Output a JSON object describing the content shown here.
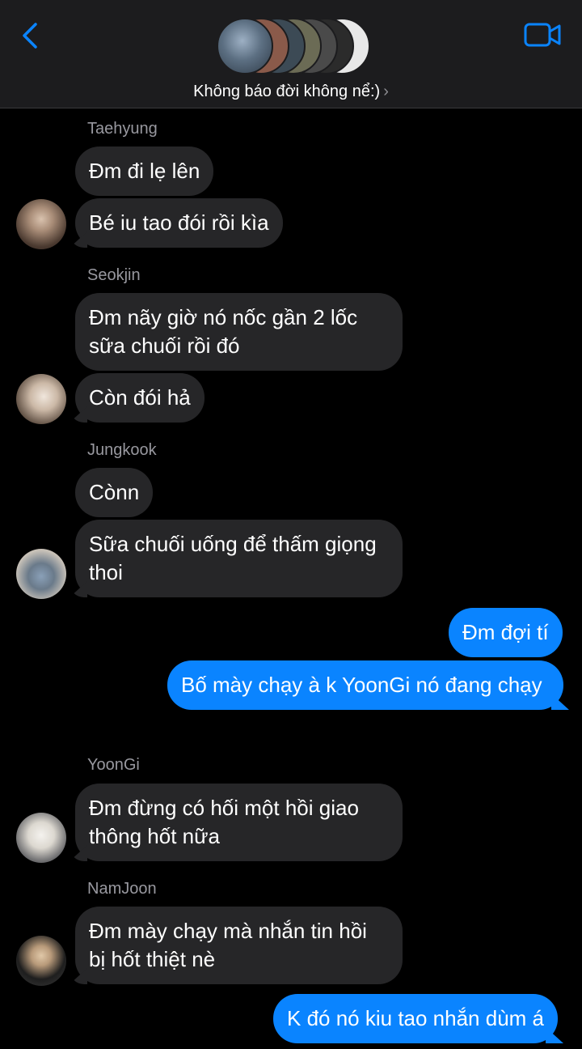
{
  "header": {
    "title": "Không báo đời không nể:)",
    "chevron": "›",
    "back_icon": "chevron-left-icon",
    "video_icon": "video-camera-icon",
    "accent": "#0a84ff",
    "group_avatar_count": 7
  },
  "messages": [
    {
      "sender": "Taehyung",
      "bubbles": [
        "Đm đi lẹ lên",
        "Bé iu tao đói rồi kìa"
      ]
    },
    {
      "sender": "Seokjin",
      "bubbles": [
        "Đm nãy giờ nó nốc gần 2 lốc sữa chuối rồi đó",
        "Còn đói hả"
      ]
    },
    {
      "sender": "Jungkook",
      "bubbles": [
        "Cònn",
        "Sữa chuối uống để thấm giọng thoi"
      ]
    },
    {
      "sender": "me",
      "bubbles": [
        "Đm đợi tí",
        "Bố mày chạy à k YoonGi nó đang chạy"
      ]
    },
    {
      "sender": "YoonGi",
      "bubbles": [
        "Đm đừng có hối một hồi giao thông hốt nữa"
      ]
    },
    {
      "sender": "NamJoon",
      "bubbles": [
        "Đm mày chạy mà nhắn tin hồi bị hốt thiệt nè"
      ]
    },
    {
      "sender": "me",
      "bubbles": [
        "K đó nó kiu tao nhắn dùm á"
      ]
    }
  ]
}
